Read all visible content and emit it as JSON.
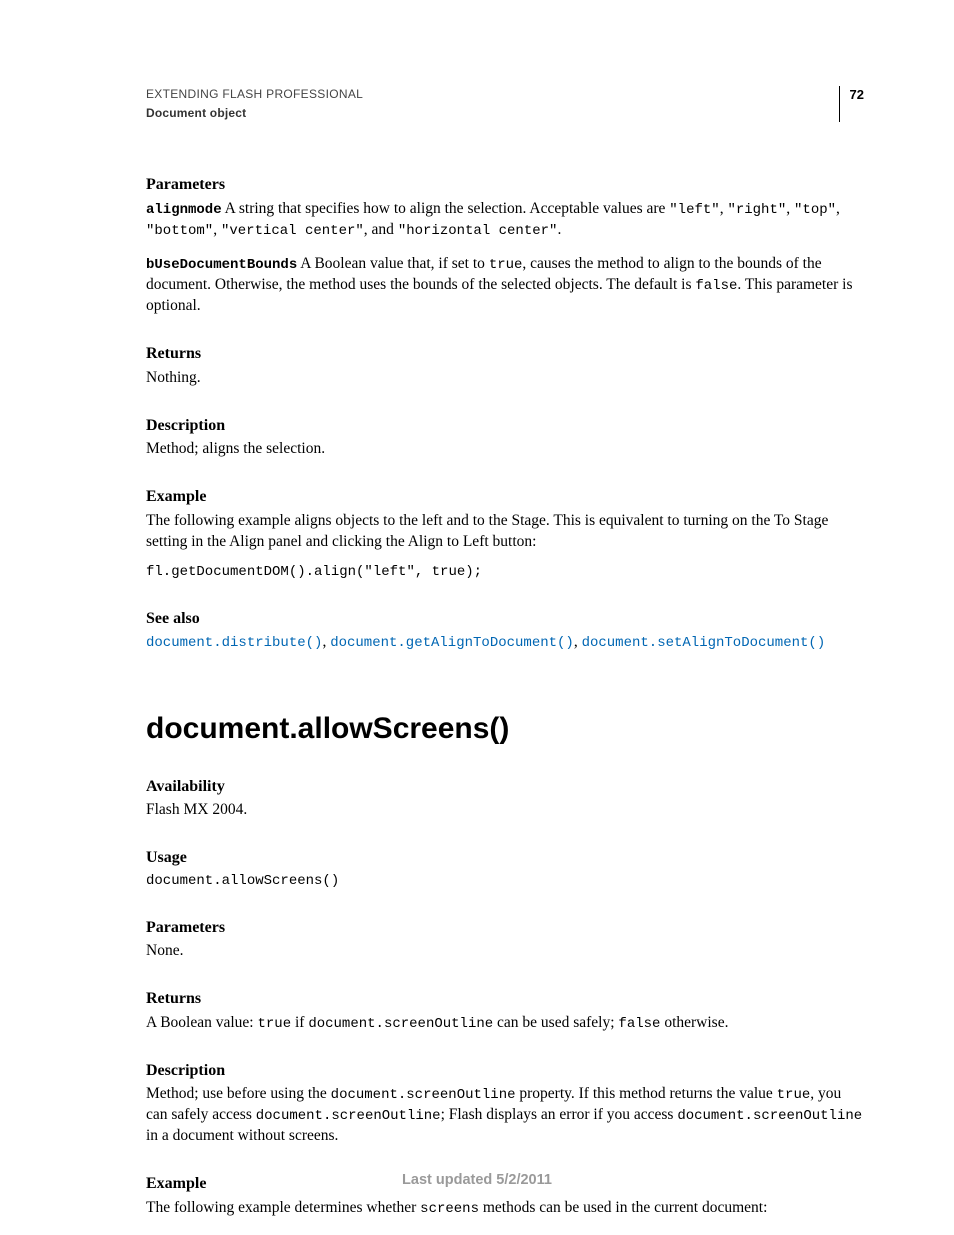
{
  "header": {
    "title": "EXTENDING FLASH PROFESSIONAL",
    "subtitle": "Document object",
    "pageNumber": "72"
  },
  "section1": {
    "parametersHeading": "Parameters",
    "alignmode_name": "alignmode",
    "alignmode_text1": "  A string that specifies how to align the selection. Acceptable values are ",
    "v_left": "\"left\"",
    "c1": ", ",
    "v_right": "\"right\"",
    "c2": ", ",
    "v_top": "\"top\"",
    "c3": ", ",
    "v_bottom": "\"bottom\"",
    "c4": ", ",
    "v_vc": "\"vertical center\"",
    "c5": ", and ",
    "v_hc": "\"horizontal center\"",
    "c6": ".",
    "bUse_name": "bUseDocumentBounds",
    "bUse_text1": "  A Boolean value that, if set to ",
    "true": "true",
    "bUse_text2": ", causes the method to align to the bounds of the document. Otherwise, the method uses the bounds of the selected objects. The default is ",
    "false": "false",
    "bUse_text3": ". This parameter is optional.",
    "returnsHeading": "Returns",
    "returnsBody": "Nothing.",
    "descriptionHeading": "Description",
    "descriptionBody": "Method; aligns the selection.",
    "exampleHeading": "Example",
    "exampleBody": "The following example aligns objects to the left and to the Stage. This is equivalent to turning on the To Stage setting in the Align panel and clicking the Align to Left button:",
    "exampleCode": "fl.getDocumentDOM().align(\"left\", true);",
    "seeAlsoHeading": "See also",
    "seeAlso1": "document.distribute()",
    "seeAlsoSep1": ", ",
    "seeAlso2": "document.getAlignToDocument()",
    "seeAlsoSep2": ", ",
    "seeAlso3": "document.setAlignToDocument()"
  },
  "section2": {
    "title": "document.allowScreens()",
    "availabilityHeading": "Availability",
    "availabilityBody": "Flash MX 2004.",
    "usageHeading": "Usage",
    "usageCode": "document.allowScreens()",
    "parametersHeading": "Parameters",
    "parametersBody": "None.",
    "returnsHeading": "Returns",
    "returns_t1": "A Boolean value: ",
    "returns_true": "true",
    "returns_t2": " if ",
    "returns_code1": "document.screenOutline",
    "returns_t3": " can be used safely; ",
    "returns_false": "false",
    "returns_t4": " otherwise.",
    "descriptionHeading": "Description",
    "desc_t1": "Method; use before using the ",
    "desc_code1": "document.screenOutline",
    "desc_t2": " property. If this method returns the value ",
    "desc_true": "true",
    "desc_t3": ", you can safely access ",
    "desc_code2": "document.screenOutline",
    "desc_t4": "; Flash displays an error if you access ",
    "desc_code3": "document.screenOutline",
    "desc_t5": " in a document without screens.",
    "exampleHeading": "Example",
    "example_t1": "The following example determines whether ",
    "example_code": "screens",
    "example_t2": " methods can be used in the current document:"
  },
  "footer": "Last updated 5/2/2011"
}
